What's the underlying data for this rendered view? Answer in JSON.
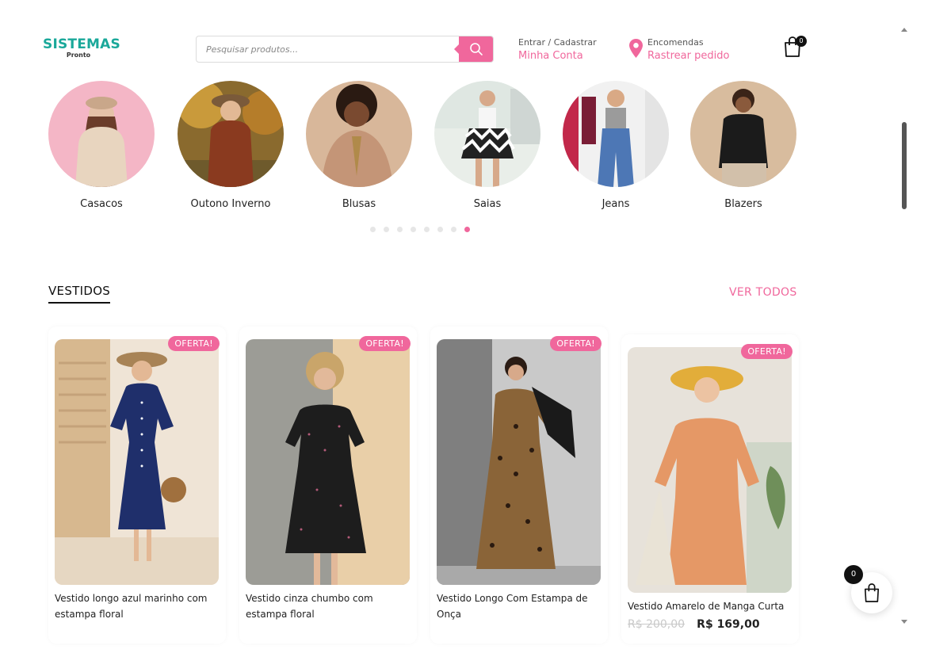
{
  "header": {
    "logo_main": "SISTEMAS",
    "logo_sub": "Pronto",
    "search_placeholder": "Pesquisar produtos...",
    "account_label": "Entrar / Cadastrar",
    "account_link": "Minha Conta",
    "orders_label": "Encomendas",
    "orders_link": "Rastrear pedido",
    "cart_count": "0"
  },
  "categories": [
    {
      "label": "Casacos"
    },
    {
      "label": "Outono Inverno"
    },
    {
      "label": "Blusas"
    },
    {
      "label": "Saias"
    },
    {
      "label": "Jeans"
    },
    {
      "label": "Blazers"
    }
  ],
  "carousel": {
    "dot_count": 8,
    "active_index": 7
  },
  "section": {
    "title": "VESTIDOS",
    "see_all": "VER TODOS"
  },
  "products": [
    {
      "badge": "OFERTA!",
      "name": "Vestido longo azul marinho com estampa floral"
    },
    {
      "badge": "OFERTA!",
      "name": "Vestido cinza chumbo com estampa floral"
    },
    {
      "badge": "OFERTA!",
      "name": "Vestido Longo Com Estampa de Onça"
    },
    {
      "badge": "OFERTA!",
      "name": "Vestido Amarelo de Manga Curta",
      "price_old": "R$ 200,00",
      "price_new": "R$ 169,00"
    }
  ],
  "floating_cart": {
    "count": "0"
  },
  "colors": {
    "accent": "#f0679c",
    "brand": "#1aa89a"
  }
}
